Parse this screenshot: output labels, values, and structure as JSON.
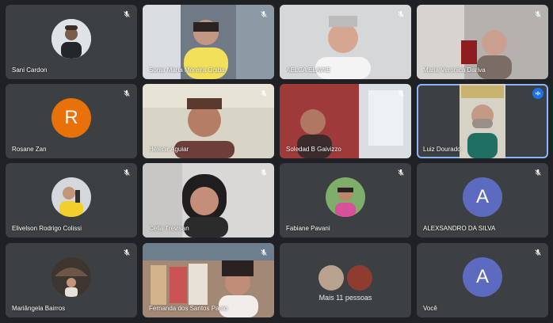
{
  "participants": [
    {
      "name": "Sani Cardon"
    },
    {
      "name": "Sonia Maria Moreira Ogiba"
    },
    {
      "name": "AELCA ELAINE"
    },
    {
      "name": "Maria Veronica Dariva"
    },
    {
      "name": "Rosane Zan",
      "initial": "R"
    },
    {
      "name": "Helenir Aguiar"
    },
    {
      "name": "Soledad B Gaivizzo"
    },
    {
      "name": "Luiz Dourado"
    },
    {
      "name": "Elivelson Rodrigo Colissi"
    },
    {
      "name": "Celia Trevisan"
    },
    {
      "name": "Fabiane Pavani"
    },
    {
      "name": "ALEXSANDRO DA SILVA",
      "initial": "A"
    },
    {
      "name": "Mariângela Bairros"
    },
    {
      "name": "Fernanda dos Santos Paulo"
    },
    {
      "more_label": "Mais 11 pessoas"
    },
    {
      "name": "Você",
      "initial": "A"
    }
  ],
  "colors": {
    "tile_bg": "#3c4043",
    "page_bg": "#202124",
    "rosane_avatar": "#e8710a",
    "blue_avatar": "#5c6bc0",
    "speaking_outline": "#8ab4f8"
  }
}
